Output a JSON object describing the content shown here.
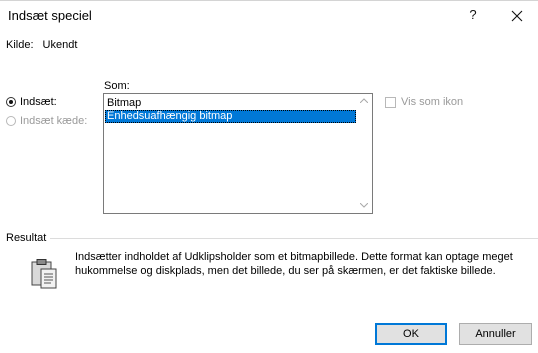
{
  "dialog": {
    "title": "Indsæt speciel",
    "help_symbol": "?",
    "close_symbol": "✕"
  },
  "source": {
    "label": "Kilde:",
    "value": "Ukendt"
  },
  "options": {
    "paste_label": "Indsæt:",
    "paste_link_label": "Indsæt kæde:",
    "paste_selected": true,
    "paste_link_enabled": false
  },
  "as_list": {
    "label": "Som:",
    "items": [
      "Bitmap",
      "Enhedsuafhængig bitmap"
    ],
    "selected_index": 1
  },
  "display_as_icon": {
    "label": "Vis som ikon",
    "checked": false,
    "enabled": false
  },
  "result": {
    "label": "Resultat",
    "text": "Indsætter indholdet af Udklipsholder som et bitmapbillede. Dette format kan optage meget hukommelse og diskplads, men det billede, du ser på skærmen, er det faktiske billede.",
    "icon": "clipboard-icon"
  },
  "buttons": {
    "ok": "OK",
    "cancel": "Annuller"
  },
  "colors": {
    "selection": "#0078d7",
    "disabled_text": "#9a9a9a"
  }
}
